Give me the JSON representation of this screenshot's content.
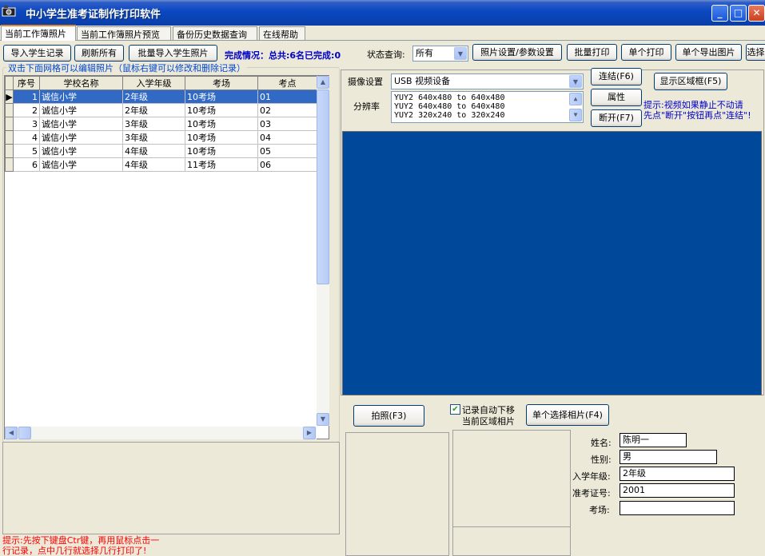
{
  "window": {
    "title": "中小学生准考证制作打印软件",
    "icon": "camera-icon",
    "minimize": "_",
    "maximize": "□",
    "close": "✕"
  },
  "tabs": [
    {
      "label": "当前工作簿照片"
    },
    {
      "label": "当前工作簿照片预览"
    },
    {
      "label": "备份历史数据查询"
    },
    {
      "label": "在线帮助"
    }
  ],
  "toolbar": {
    "import_students": "导入学生记录",
    "refresh_all": "刷新所有",
    "batch_import_photos": "批量导入学生照片",
    "completion": "完成情况：总共:6名已完成:0",
    "status_label": "状态查询:",
    "status_value": "所有",
    "photo_settings": "照片设置/参数设置",
    "batch_print": "批量打印",
    "single_print": "单个打印",
    "single_export": "单个导出图片",
    "select_truncated": "选择"
  },
  "grid": {
    "caption": "双击下面网格可以编辑照片（鼠标右键可以修改和删除记录）",
    "columns": [
      "序号",
      "学校名称",
      "入学年级",
      "考场",
      "考点"
    ],
    "rows": [
      {
        "no": "1",
        "school": "诚信小学",
        "grade": "2年级",
        "room": "10考场",
        "site": "01"
      },
      {
        "no": "2",
        "school": "诚信小学",
        "grade": "2年级",
        "room": "10考场",
        "site": "02"
      },
      {
        "no": "3",
        "school": "诚信小学",
        "grade": "3年级",
        "room": "10考场",
        "site": "03"
      },
      {
        "no": "4",
        "school": "诚信小学",
        "grade": "3年级",
        "room": "10考场",
        "site": "04"
      },
      {
        "no": "5",
        "school": "诚信小学",
        "grade": "4年级",
        "room": "10考场",
        "site": "05"
      },
      {
        "no": "6",
        "school": "诚信小学",
        "grade": "4年级",
        "room": "11考场",
        "site": "06"
      }
    ]
  },
  "hint_left": "提示:先按下键盘Ctr键，再用鼠标点击一\n行记录，点中几行就选择几行打印了!",
  "camera": {
    "device_label": "摄像设置",
    "device_value": "USB 视频设备",
    "resolution_label": "分辨率",
    "resolutions": [
      "YUY2 640x480 to 640x480",
      "YUY2 640x480 to 640x480",
      "YUY2 320x240 to 320x240"
    ],
    "connect": "连结(F6)",
    "properties": "属性",
    "disconnect": "断开(F7)",
    "show_frame": "显示区域框(F5)",
    "hint_line1": "提示:视频如果静止不动请",
    "hint_line2": "先点\"断开\"按钮再点\"连结\"!"
  },
  "capture": {
    "shoot": "拍照(F3)",
    "auto_move_checked": true,
    "auto_move_label_1": "记录自动下移",
    "auto_move_label_2": "当前区域相片",
    "select_photo": "单个选择相片(F4)"
  },
  "student": {
    "name_label": "姓名:",
    "name_value": "陈明一",
    "gender_label": "性别:",
    "gender_value": "男",
    "grade_label": "入学年级:",
    "grade_value": "2年级",
    "ticket_label": "准考证号:",
    "ticket_value": "2001",
    "room_label": "考场:",
    "room_value": ""
  }
}
